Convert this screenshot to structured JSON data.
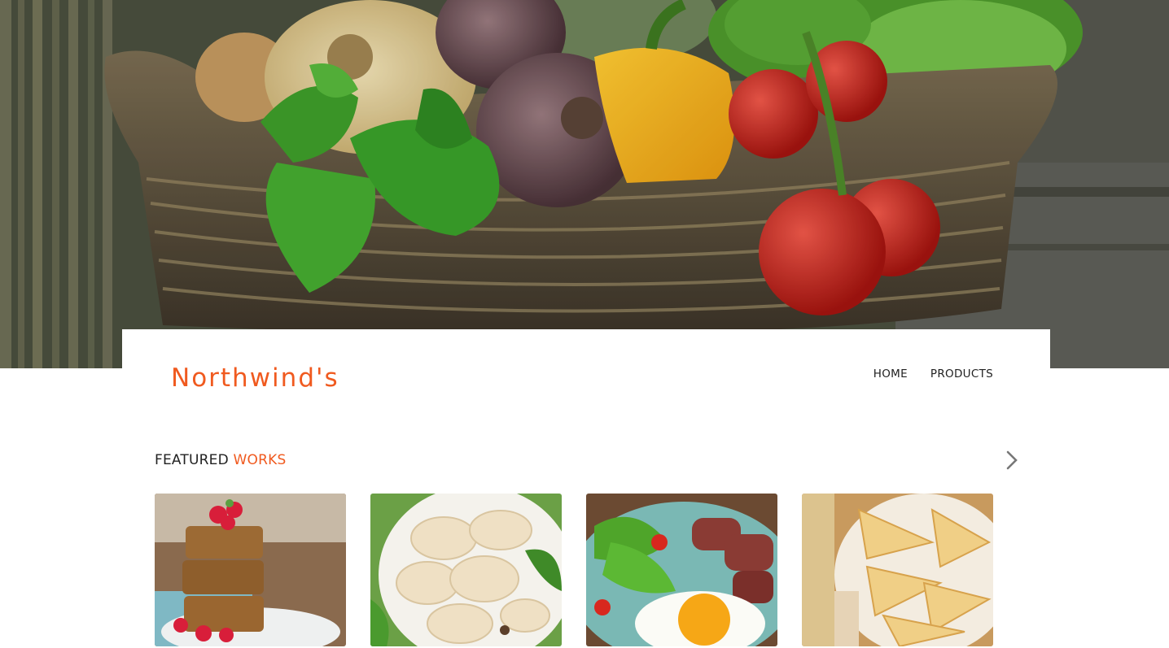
{
  "hero": {
    "image_name": "vegetable-basket-hero"
  },
  "header": {
    "brand": "Northwind's",
    "nav": [
      "HOME",
      "PRODUCTS"
    ]
  },
  "featured": {
    "title_part1": "FEATURED",
    "title_part2": "WORKS",
    "next_icon": "chevron-right-icon",
    "items": [
      {
        "image_name": "raspberry-bars"
      },
      {
        "image_name": "dumplings"
      },
      {
        "image_name": "steak-and-egg-plate"
      },
      {
        "image_name": "crepes"
      }
    ]
  },
  "colors": {
    "accent": "#f05a1f",
    "text": "#222222"
  }
}
